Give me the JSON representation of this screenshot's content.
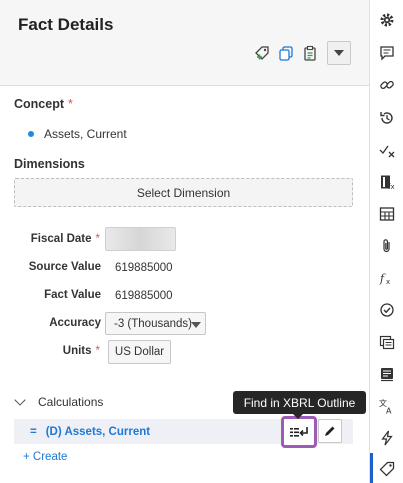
{
  "panel": {
    "title": "Fact Details",
    "header_icons": [
      "add-tag-icon",
      "copy-icon",
      "clipboard-icon",
      "caret-down-icon"
    ]
  },
  "concept": {
    "label": "Concept",
    "required": "*",
    "value": "Assets, Current"
  },
  "dimensions": {
    "label": "Dimensions",
    "select_button": "Select Dimension"
  },
  "fields": {
    "fiscal_date_label": "Fiscal Date",
    "fiscal_date_required": "*",
    "source_value_label": "Source Value",
    "source_value": "619885000",
    "fact_value_label": "Fact Value",
    "fact_value": "619885000",
    "accuracy_label": "Accuracy",
    "accuracy_value": "-3 (Thousands)",
    "units_label": "Units",
    "units_required": "*",
    "units_value": "US Dollar"
  },
  "calculations": {
    "label": "Calculations",
    "row_prefix": "=",
    "row_label": "(D) Assets, Current",
    "create_link": "+ Create",
    "tooltip": "Find in XBRL Outline"
  },
  "rail": {
    "icons": [
      "gear-icon",
      "comment-icon",
      "link-icon",
      "history-icon",
      "check-x-icon",
      "formula-book-icon",
      "table-icon",
      "attachment-icon",
      "fx-icon",
      "check-circle-icon",
      "notes-icon",
      "note-stack-icon",
      "translate-icon",
      "bolt-icon",
      "tag-icon"
    ]
  },
  "colors": {
    "accent": "#1e78d6",
    "highlight_border": "#9c5bb5",
    "required": "#d9534f",
    "tooltip_bg": "#262626"
  }
}
